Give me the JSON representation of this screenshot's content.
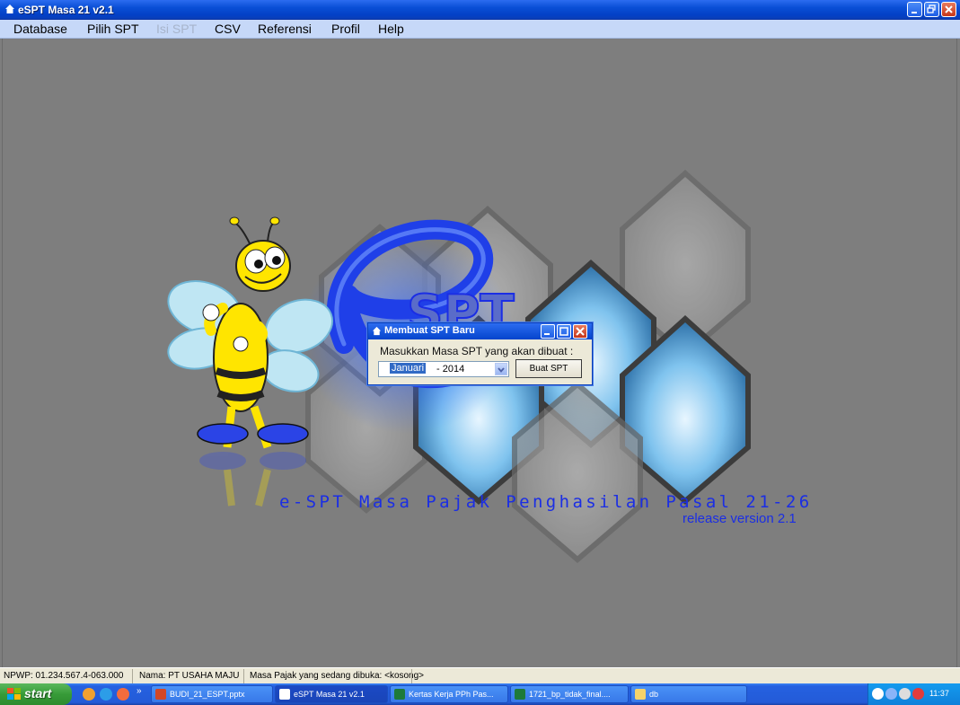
{
  "window": {
    "title": "eSPT Masa 21 v2.1"
  },
  "menu": {
    "items": [
      {
        "label": "Database",
        "enabled": true
      },
      {
        "label": "Pilih SPT",
        "enabled": true
      },
      {
        "label": "Isi SPT",
        "enabled": false
      },
      {
        "label": "CSV",
        "enabled": true
      },
      {
        "label": "Referensi",
        "enabled": true
      },
      {
        "label": "Profil",
        "enabled": true
      },
      {
        "label": "Help",
        "enabled": true
      }
    ]
  },
  "splash": {
    "logo_text": "eSPT",
    "title": "e-SPT Masa Pajak Penghasilan Pasal 21-26",
    "version": "release version 2.1"
  },
  "dialog": {
    "title": "Membuat SPT Baru",
    "prompt": "Masukkan Masa SPT yang akan dibuat :",
    "month_value": "Januari",
    "year_value": "- 2014",
    "create_button": "Buat SPT"
  },
  "status": {
    "npwp": "NPWP: 01.234.567.4-063.000",
    "nama": "Nama: PT USAHA MAJU",
    "masa_pajak": "Masa Pajak yang sedang dibuka: <kosong>"
  },
  "taskbar": {
    "start_label": "start",
    "overflow": "»",
    "buttons": [
      {
        "label": "BUDI_21_ESPT.pptx",
        "active": false,
        "icon_color": "#d24726"
      },
      {
        "label": "eSPT Masa 21 v2.1",
        "active": true,
        "icon_color": "#ffffff"
      },
      {
        "label": "Kertas Kerja PPh Pas...",
        "active": false,
        "icon_color": "#1d7a3a"
      },
      {
        "label": "1721_bp_tidak_final....",
        "active": false,
        "icon_color": "#1d7a3a"
      },
      {
        "label": "db",
        "active": false,
        "icon_color": "#f5d36a"
      }
    ],
    "clock": "11:37"
  },
  "colors": {
    "titlebar": "#0a4fd6",
    "menubar": "#c6d8f8",
    "desktop": "#7e7e7e",
    "splash_text": "#1b2ee4"
  }
}
